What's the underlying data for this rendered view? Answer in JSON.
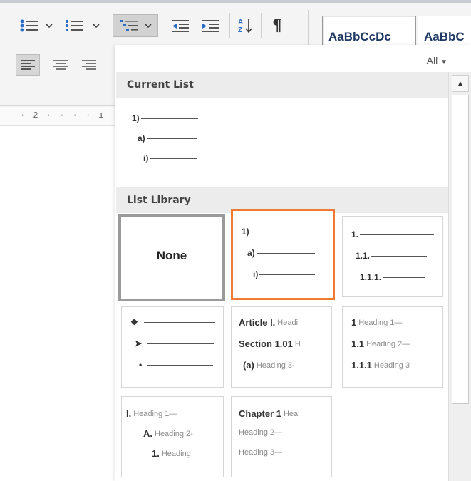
{
  "ribbon": {
    "styles": [
      "AaBbCcDc",
      "AaBbC"
    ],
    "ruler_text": "· 2 · · · · ı",
    "icons": [
      "bullets-icon",
      "chevron-down-icon",
      "numbering-icon",
      "chevron-down-icon",
      "multilevel-list-icon",
      "chevron-down-icon",
      "decrease-indent-icon",
      "increase-indent-icon",
      "sort-icon",
      "pilcrow-icon",
      "align-left-icon",
      "align-center-icon",
      "align-right-icon"
    ]
  },
  "panel": {
    "filter_label": "All",
    "current_section": "Current List",
    "library_section": "List Library",
    "current_tile": {
      "lines": [
        "1)",
        "a)",
        "i)"
      ]
    },
    "library": [
      {
        "type": "none",
        "label": "None"
      },
      {
        "type": "list",
        "lines": [
          "1)",
          "a)",
          "i)"
        ],
        "selected": true
      },
      {
        "type": "list",
        "lines": [
          "1.",
          "1.1.",
          "1.1.1."
        ]
      },
      {
        "type": "bullets",
        "lines": [
          "❖",
          "➤",
          "•"
        ]
      },
      {
        "type": "headings",
        "lines": [
          [
            "Article I.",
            "Headi"
          ],
          [
            "Section 1.01",
            "H"
          ],
          [
            "(a)",
            "Heading 3-"
          ]
        ]
      },
      {
        "type": "headings",
        "lines": [
          [
            "1",
            "Heading 1—"
          ],
          [
            "1.1",
            "Heading 2—"
          ],
          [
            "1.1.1",
            "Heading 3"
          ]
        ]
      },
      {
        "type": "headings",
        "lines": [
          [
            "I.",
            "Heading 1—"
          ],
          [
            "A.",
            "Heading 2-"
          ],
          [
            "1.",
            "Heading"
          ]
        ]
      },
      {
        "type": "headings",
        "lines": [
          [
            "Chapter 1",
            "Hea"
          ],
          [
            "",
            "Heading 2—"
          ],
          [
            "",
            "Heading 3—"
          ]
        ]
      }
    ]
  },
  "colors": {
    "accent": "#f07a31",
    "ribbon_bg": "#f4f4f4",
    "section_bg": "#ececec",
    "style_text": "#1f3864"
  }
}
